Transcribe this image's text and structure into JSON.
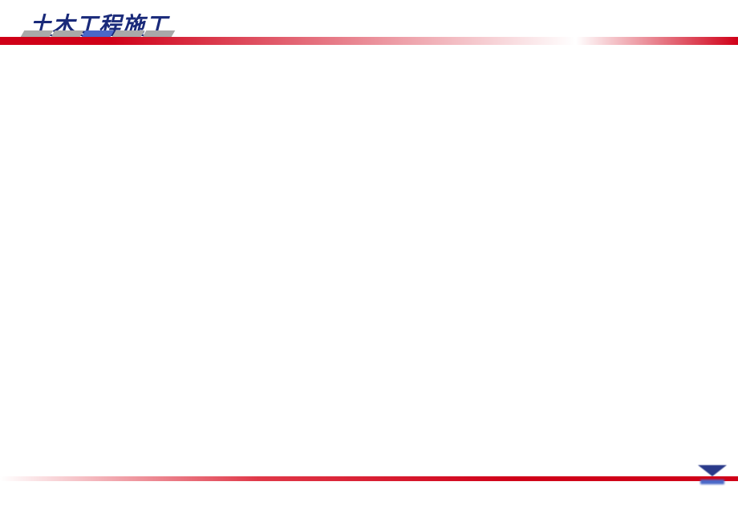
{
  "header": {
    "title": "土木工程施工"
  },
  "decor": {
    "paraColors": [
      "gray",
      "gray",
      "blue",
      "gray",
      "gray"
    ]
  }
}
